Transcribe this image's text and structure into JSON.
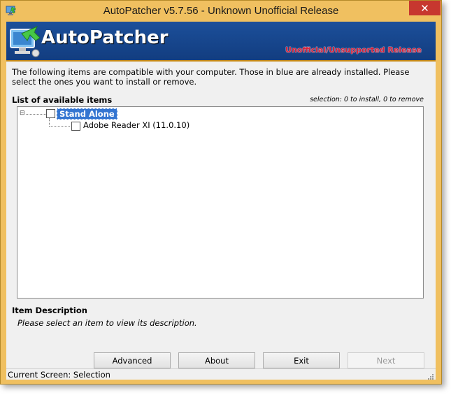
{
  "window": {
    "title": "AutoPatcher v5.7.56 - Unknown Unofficial Release",
    "close_glyph": "✕"
  },
  "banner": {
    "title": "AutoPatcher",
    "subtitle": "Unofficial/Unsupported Release",
    "logo_icon": "computer-arrow-icon"
  },
  "intro_text": "The following items are compatible with your computer. Those in blue are already installed. Please select the ones you want to install or remove.",
  "list": {
    "label": "List of available items",
    "selection_info": "selection: 0 to install, 0 to remove",
    "expander_glyph": "⊟",
    "items": [
      {
        "label": "Stand Alone",
        "checked": false,
        "selected": true
      },
      {
        "label": "Adobe Reader XI (11.0.10)",
        "checked": false,
        "selected": false
      }
    ]
  },
  "description": {
    "label": "Item Description",
    "text": "Please select an item to view its description."
  },
  "buttons": {
    "advanced": "Advanced",
    "about": "About",
    "exit": "Exit",
    "next": "Next"
  },
  "status": {
    "text": "Current Screen: Selection"
  },
  "colors": {
    "frame": "#f0c060",
    "banner": "#1c4f9a",
    "subtitle": "#d4203a",
    "selection": "#3375d1",
    "close": "#c7372f"
  }
}
